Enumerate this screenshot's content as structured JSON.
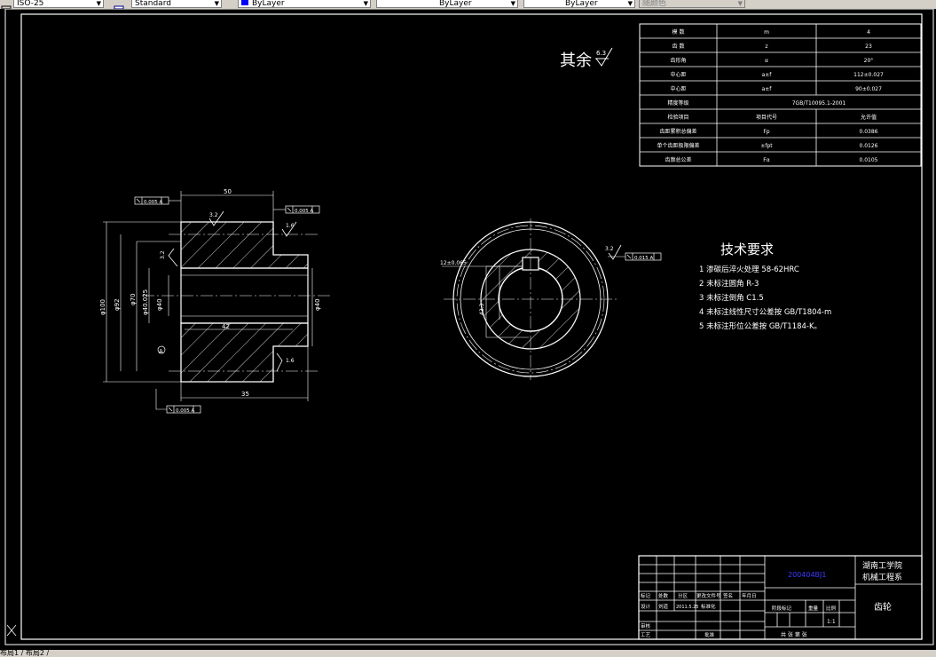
{
  "toolbar": {
    "scale_combo": "ISO-25",
    "style_combo": "Standard",
    "layer_combo": "ByLayer",
    "linetype_combo": "ByLayer",
    "lineweight_combo": "ByLayer",
    "color_combo": "随颜色"
  },
  "status": {
    "tabs": "布局1 / 布局2 /"
  },
  "drawing": {
    "surface_note": "其余",
    "surface_value": "6.3",
    "tech_title": "技术要求",
    "tech_items": [
      "1 渗碳后淬火处理 58-62HRC",
      "2 未标注圆角 R-3",
      "3 未标注倒角 C1.5",
      "4 未标注线性尺寸公差按 GB/T1804-m",
      "5 未标注形位公差按 GB/T1184-K。"
    ],
    "param_table": [
      [
        "模 数",
        "m",
        "4"
      ],
      [
        "齿 数",
        "z",
        "23"
      ],
      [
        "齿形角",
        "α",
        "20°"
      ],
      [
        "中心距",
        "a±f",
        "112±0.027"
      ],
      [
        "中心距",
        "a±f",
        "90±0.027"
      ],
      [
        "精度等级",
        "7GB/T10095.1-2001",
        ""
      ],
      [
        "检验项目",
        "项目代号",
        "允许值"
      ],
      [
        "齿距累积总偏差",
        "Fp",
        "0.0386"
      ],
      [
        "单个齿距极限偏差",
        "±fpt",
        "0.0126"
      ],
      [
        "齿廓总公差",
        "Fα",
        "0.0105"
      ]
    ],
    "dims": {
      "left_top_tol": "0.005 A",
      "left_bottom_tol": "0.005 A",
      "right_top_tol": "0.005 A",
      "keyway_tol": "0.015 A",
      "keyway_dim": "12±0.065",
      "width_top": "50",
      "width_bottom": "35",
      "dia_outer": "φ100",
      "dia_mid": "φ92",
      "dia_inner": "φ40",
      "dia_bore": "φ40.025",
      "dia_hub": "φ70",
      "length_mid": "42",
      "roughness_a": "3.2",
      "roughness_b": "1.6",
      "roughness_c": "3.2",
      "roughness_d": "1.6",
      "roughness_e": "3.2",
      "datum": "A",
      "key_depth": "43.3",
      "bore_label": "φ40"
    },
    "title_block": {
      "drawing_no": "200404BJ1",
      "school_line1": "湖南工学院",
      "school_line2": "机械工程系",
      "part_name": "齿轮",
      "scale": "1:1",
      "rows": [
        "标记",
        "处数",
        "分区",
        "更改文件号",
        "签名",
        "年月日"
      ],
      "designer": "设计",
      "designer_name": "刘道",
      "date_note": "2011.5.25",
      "std_note": "标准化",
      "review": "审核",
      "process": "工艺",
      "approve": "批准",
      "stage_label": "阶段标记",
      "weight_label": "重量",
      "ratio_label": "比例",
      "sheets": "共  张  第  张"
    }
  }
}
